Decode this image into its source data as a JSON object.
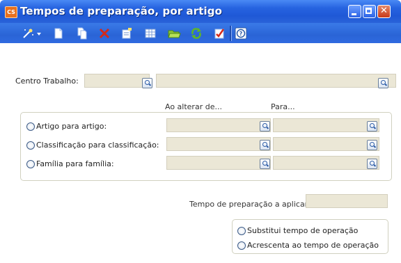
{
  "window": {
    "title": "Tempos de preparação, por artigo",
    "icon": "app-icon",
    "buttons": [
      "minimize",
      "maximize",
      "close"
    ]
  },
  "toolbar": {
    "icons": [
      "wand-dropdown-icon",
      "new-document-icon",
      "copy-document-icon",
      "delete-icon",
      "properties-icon",
      "grid-icon",
      "open-folder-icon",
      "refresh-icon",
      "validate-icon",
      "help-icon"
    ]
  },
  "form": {
    "centro_label": "Centro Trabalho:",
    "col_from": "Ao alterar de...",
    "col_to": "Para...",
    "rows": [
      {
        "label": "Artigo para artigo:"
      },
      {
        "label": "Classificação para classificação:"
      },
      {
        "label": "Família para família:"
      }
    ],
    "tempo_label": "Tempo de preparação a aplicar:",
    "options": [
      {
        "label": "Substitui tempo de operação"
      },
      {
        "label": "Acrescenta ao tempo de operação"
      }
    ]
  },
  "colors": {
    "titlebar": "#2663e0",
    "field_bg": "#ebe7d6",
    "delete_red": "#d42a1a"
  }
}
